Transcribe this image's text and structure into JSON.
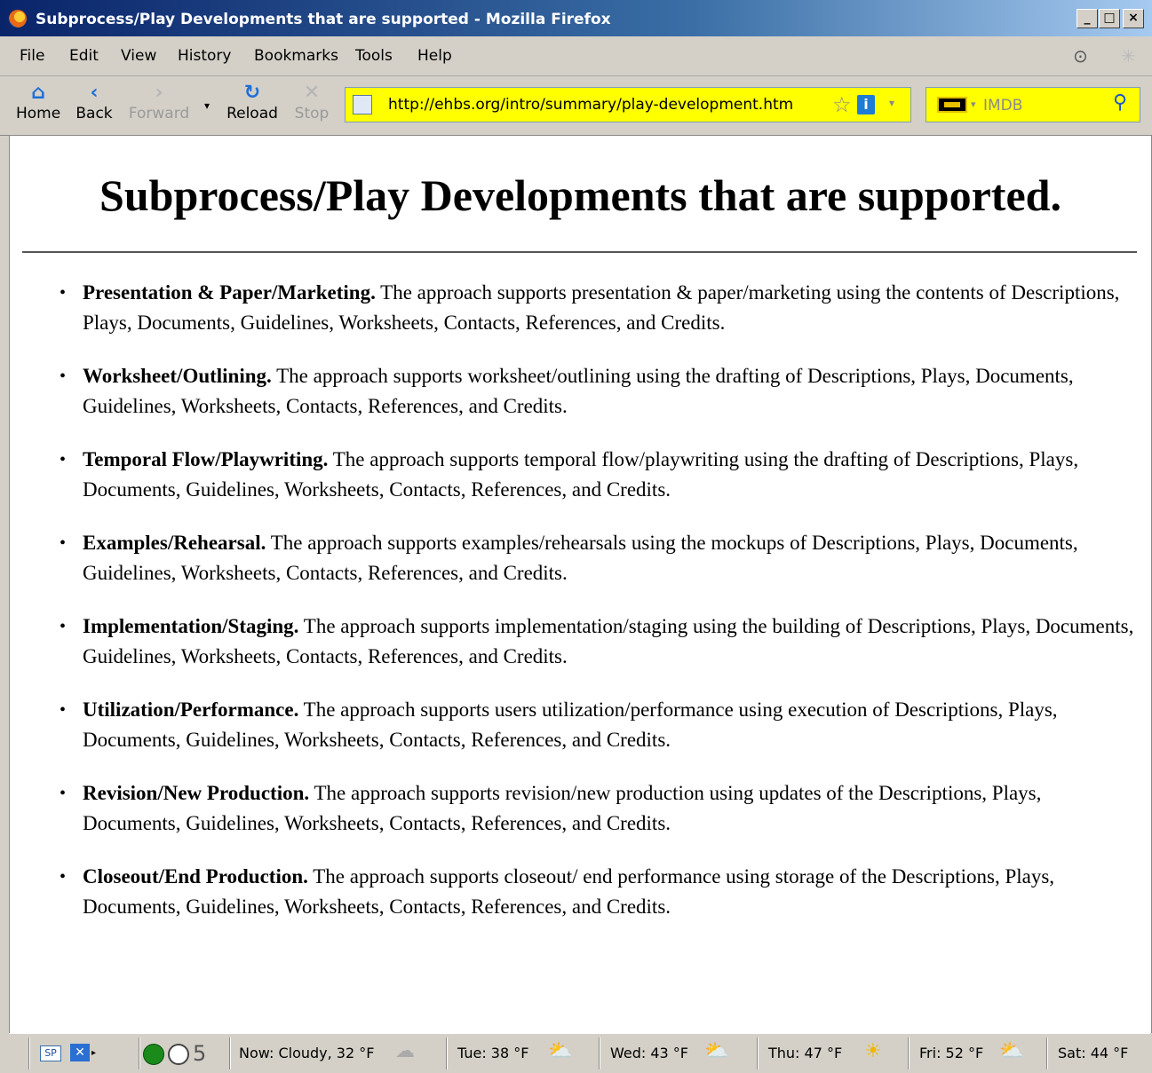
{
  "window": {
    "title": "Subprocess/Play Developments that are supported - Mozilla Firefox",
    "app_icon": "firefox-icon"
  },
  "menu": {
    "items": [
      "File",
      "Edit",
      "View",
      "History",
      "Bookmarks",
      "Tools",
      "Help"
    ]
  },
  "toolbar": {
    "home_label": "Home",
    "back_label": "Back",
    "forward_label": "Forward",
    "reload_label": "Reload",
    "stop_label": "Stop",
    "url": "http://ehbs.org/intro/summary/play-development.htm",
    "search_placeholder": "IMDB"
  },
  "page": {
    "title": "Subprocess/Play Developments that are supported.",
    "items": [
      {
        "heading": "Presentation & Paper/Marketing.",
        "text": " The approach supports presentation & paper/marketing using the contents of Descriptions, Plays, Documents, Guidelines, Worksheets, Contacts, References, and Credits."
      },
      {
        "heading": "Worksheet/Outlining.",
        "text": " The approach supports worksheet/outlining using the drafting of Descriptions, Plays, Documents, Guidelines, Worksheets, Contacts, References, and Credits."
      },
      {
        "heading": "Temporal Flow/Playwriting.",
        "text": " The approach supports temporal flow/playwriting using the drafting of Descriptions, Plays, Documents, Guidelines, Worksheets, Contacts, References, and Credits."
      },
      {
        "heading": "Examples/Rehearsal.",
        "text": " The approach supports examples/rehearsals using the mockups of Descriptions, Plays, Documents, Guidelines, Worksheets, Contacts, References, and Credits."
      },
      {
        "heading": "Implementation/Staging.",
        "text": " The approach supports implementation/staging using the building of Descriptions, Plays, Documents, Guidelines, Worksheets, Contacts, References, and Credits."
      },
      {
        "heading": "Utilization/Performance.",
        "text": " The approach supports users utilization/performance using execution of Descriptions, Plays, Documents, Guidelines, Worksheets, Contacts, References, and Credits."
      },
      {
        "heading": "Revision/New Production.",
        "text": " The approach supports revision/new production using updates of the Descriptions, Plays, Documents, Guidelines, Worksheets, Contacts, References, and Credits."
      },
      {
        "heading": "Closeout/End Production.",
        "text": " The approach supports closeout/ end performance using storage of the Descriptions, Plays, Documents, Guidelines, Worksheets, Contacts, References, and Credits."
      }
    ]
  },
  "statusbar": {
    "sp_label": "SP",
    "counter": "5",
    "weather_now": "Now: Cloudy, 32 °F",
    "tue": "Tue: 38 °F",
    "wed": "Wed: 43 °F",
    "thu": "Thu: 47 °F",
    "fri": "Fri: 52 °F",
    "sat": "Sat: 44 °F"
  }
}
